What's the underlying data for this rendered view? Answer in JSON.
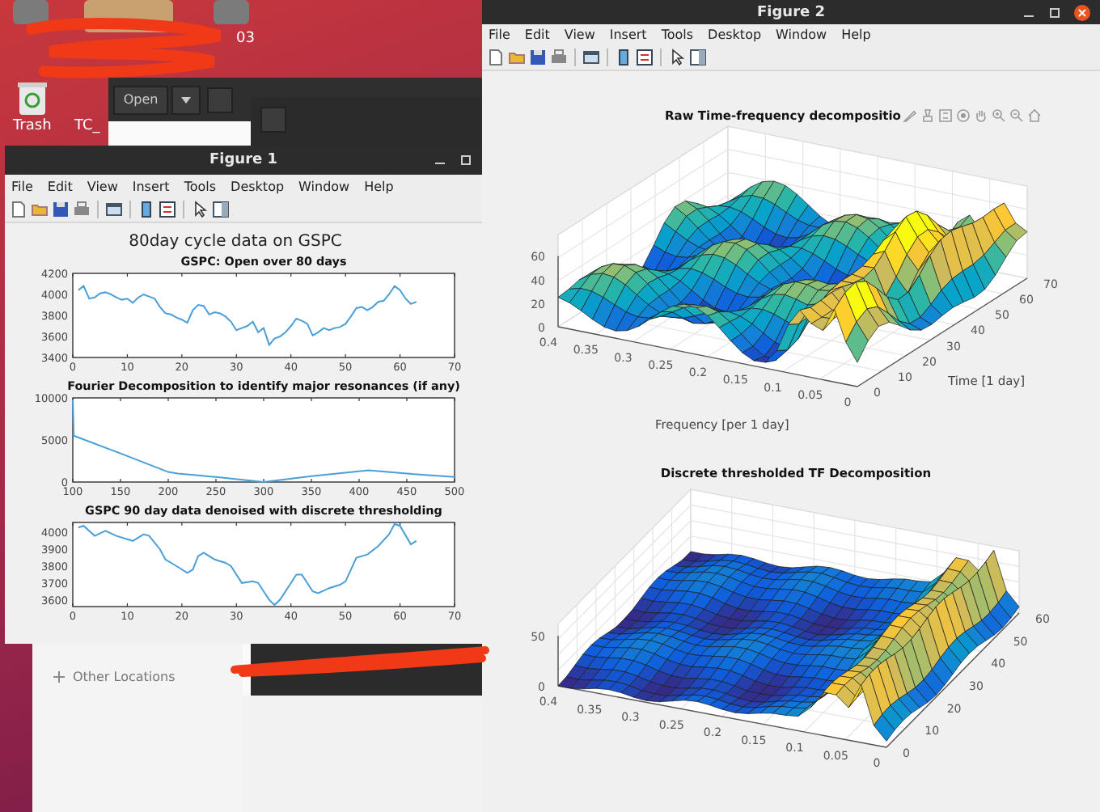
{
  "desktop": {
    "icons": [
      {
        "label": "03"
      },
      {
        "label": "Trash"
      },
      {
        "label": "TC_"
      }
    ]
  },
  "file_manager": {
    "open_button": "Open",
    "sidebar_items": [
      "Other Locations"
    ]
  },
  "figure1": {
    "title": "Figure 1",
    "menu": [
      "File",
      "Edit",
      "View",
      "Insert",
      "Tools",
      "Desktop",
      "Window",
      "Help"
    ],
    "suptitle": "80day cycle data on GSPC",
    "plots": [
      {
        "chart_data": {
          "type": "line",
          "title": "GSPC: Open over 80 days",
          "x": [
            1,
            2,
            3,
            4,
            5,
            6,
            7,
            8,
            9,
            10,
            11,
            12,
            13,
            14,
            15,
            16,
            17,
            18,
            19,
            20,
            21,
            22,
            23,
            24,
            25,
            26,
            27,
            28,
            29,
            30,
            31,
            32,
            33,
            34,
            35,
            36,
            37,
            38,
            39,
            40,
            41,
            42,
            43,
            44,
            45,
            46,
            47,
            48,
            49,
            50,
            51,
            52,
            53,
            54,
            55,
            56,
            57,
            58,
            59,
            60,
            61,
            62,
            63
          ],
          "values": [
            4040,
            4080,
            3960,
            3970,
            4010,
            4020,
            4000,
            3970,
            3950,
            3960,
            3920,
            3970,
            4000,
            3980,
            3960,
            3880,
            3820,
            3810,
            3780,
            3760,
            3730,
            3850,
            3900,
            3890,
            3810,
            3830,
            3820,
            3790,
            3740,
            3660,
            3680,
            3700,
            3740,
            3640,
            3680,
            3520,
            3580,
            3600,
            3640,
            3700,
            3770,
            3750,
            3720,
            3610,
            3640,
            3680,
            3660,
            3680,
            3690,
            3720,
            3790,
            3870,
            3880,
            3850,
            3880,
            3930,
            3940,
            4000,
            4080,
            4040,
            3960,
            3910,
            3930
          ],
          "xlim": [
            0,
            70
          ],
          "ylim": [
            3400,
            4200
          ],
          "xticks": [
            0,
            10,
            20,
            30,
            40,
            50,
            60,
            70
          ],
          "yticks": [
            3400,
            3600,
            3800,
            4000,
            4200
          ]
        }
      },
      {
        "chart_data": {
          "type": "line",
          "title": "Fourier Decomposition to identify major resonances (if any)",
          "x": [
            100,
            101,
            150,
            200,
            210,
            250,
            300,
            350,
            410,
            450,
            500
          ],
          "values": [
            9800,
            5500,
            3400,
            1200,
            1000,
            600,
            0,
            700,
            1400,
            1000,
            600
          ],
          "xlim": [
            100,
            500
          ],
          "ylim": [
            0,
            10000
          ],
          "xticks": [
            100,
            150,
            200,
            250,
            300,
            350,
            400,
            450,
            500
          ],
          "yticks": [
            0,
            5000,
            10000
          ]
        }
      },
      {
        "chart_data": {
          "type": "line",
          "title": "GSPC 90 day data denoised with discrete thresholding",
          "x": [
            1,
            2,
            4,
            6,
            8,
            10,
            11,
            13,
            14,
            16,
            17,
            19,
            21,
            22,
            23,
            24,
            26,
            28,
            29,
            31,
            33,
            34,
            35,
            36,
            37,
            38,
            40,
            41,
            42,
            44,
            45,
            47,
            49,
            50,
            52,
            54,
            56,
            58,
            59,
            60,
            62,
            63
          ],
          "values": [
            4030,
            4040,
            3980,
            4010,
            3980,
            3960,
            3950,
            3990,
            3980,
            3900,
            3840,
            3800,
            3760,
            3780,
            3860,
            3880,
            3840,
            3820,
            3800,
            3700,
            3710,
            3700,
            3650,
            3600,
            3570,
            3600,
            3700,
            3750,
            3750,
            3650,
            3640,
            3670,
            3690,
            3710,
            3850,
            3870,
            3920,
            3990,
            4050,
            4040,
            3930,
            3950
          ],
          "xlim": [
            0,
            70
          ],
          "ylim": [
            3560,
            4060
          ],
          "xticks": [
            0,
            10,
            20,
            30,
            40,
            50,
            60,
            70
          ],
          "yticks": [
            3600,
            3700,
            3800,
            3900,
            4000
          ]
        }
      }
    ]
  },
  "figure2": {
    "title": "Figure 2",
    "menu": [
      "File",
      "Edit",
      "View",
      "Insert",
      "Tools",
      "Desktop",
      "Window",
      "Help"
    ],
    "surfaces": [
      {
        "title": "Raw Time-frequency decompositio",
        "xlabel": "Frequency [per 1 day]",
        "ylabel": "Time [1 day]",
        "z_ticks": [
          "60",
          "40",
          "20",
          "0"
        ],
        "freq_ticks": [
          "0.4",
          "0.35",
          "0.3",
          "0.25",
          "0.2",
          "0.15",
          "0.1",
          "0.05",
          "0"
        ],
        "time_ticks": [
          "0",
          "10",
          "20",
          "30",
          "40",
          "50",
          "60",
          "70"
        ]
      },
      {
        "title": "Discrete thresholded TF Decomposition",
        "z_ticks": [
          "50",
          "0"
        ],
        "freq_ticks": [
          "0.4",
          "0.35",
          "0.3",
          "0.25",
          "0.2",
          "0.15",
          "0.1",
          "0.05",
          "0"
        ],
        "time_ticks": [
          "0",
          "10",
          "20",
          "30",
          "40",
          "50",
          "60"
        ]
      }
    ]
  }
}
